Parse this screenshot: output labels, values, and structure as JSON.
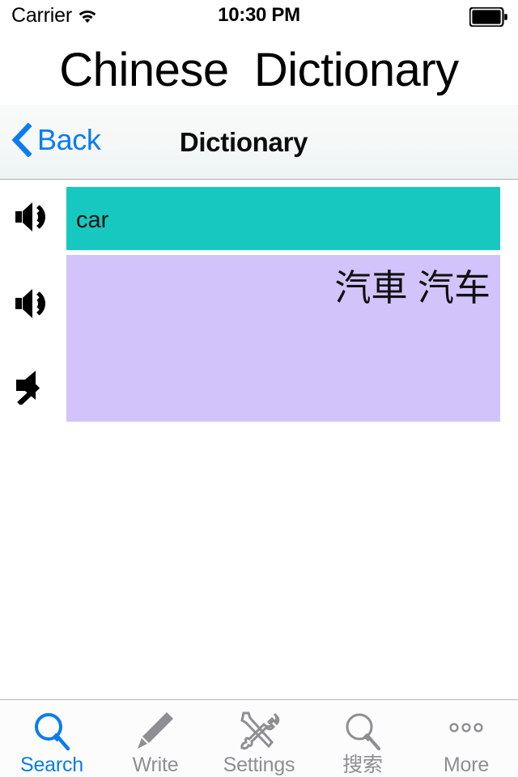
{
  "status_bar": {
    "carrier": "Carrier",
    "wifi_icon": "wifi-icon",
    "time": "10:30 PM",
    "battery_icon": "battery-full-icon"
  },
  "app_title": "Chinese  Dictionary",
  "nav_bar": {
    "back_icon": "chevron-left-icon",
    "back_label": "Back",
    "title": "Dictionary",
    "back_color": "#0a7cf0"
  },
  "entry": {
    "audio_buttons": [
      {
        "icon": "speaker-on-icon",
        "state": "on"
      },
      {
        "icon": "speaker-on-icon",
        "state": "on"
      },
      {
        "icon": "speaker-muted-icon",
        "state": "muted"
      }
    ],
    "english": {
      "text": "car",
      "background": "#17c8c0"
    },
    "chinese": {
      "text": "汽車 汽车",
      "traditional": "汽車",
      "simplified": "汽车",
      "background": "#d2c4fb"
    }
  },
  "tab_bar": {
    "active_color": "#0a7cf0",
    "inactive_color": "#8e8e93",
    "items": [
      {
        "label": "Search",
        "icon": "magnifier-icon",
        "active": true
      },
      {
        "label": "Write",
        "icon": "pencil-icon",
        "active": false
      },
      {
        "label": "Settings",
        "icon": "tools-icon",
        "active": false
      },
      {
        "label": "搜索",
        "icon": "magnifier-icon",
        "active": false
      },
      {
        "label": "More",
        "icon": "ellipsis-icon",
        "active": false
      }
    ]
  }
}
